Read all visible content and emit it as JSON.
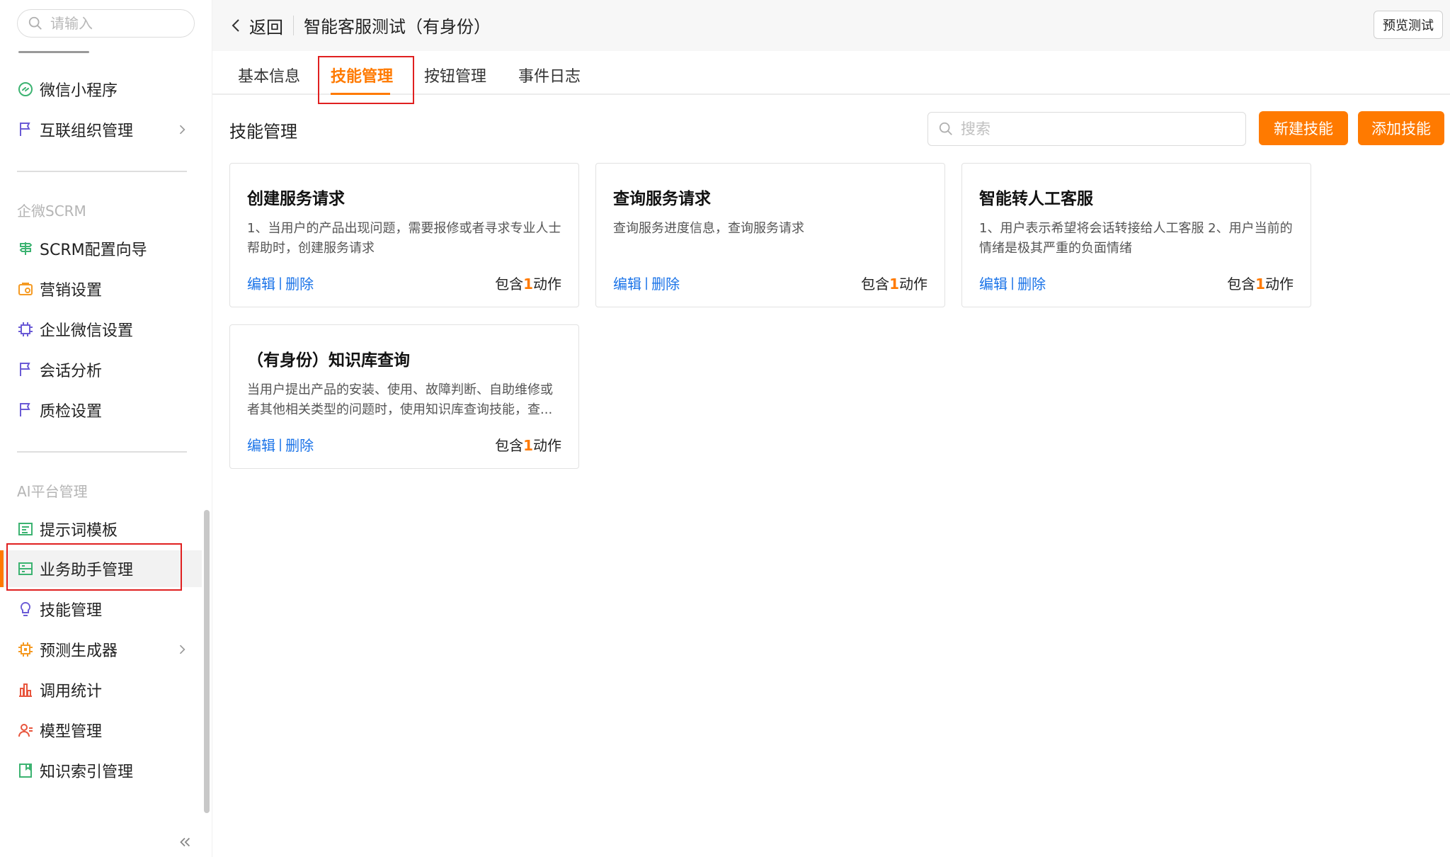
{
  "sidebar": {
    "search_placeholder": "请输入",
    "items_top": [
      {
        "label": "微信小程序",
        "icon": "wechat-mini-program-icon"
      },
      {
        "label": "互联组织管理",
        "icon": "flag-icon",
        "has_children": true
      }
    ],
    "group_scrm": {
      "title": "企微SCRM",
      "items": [
        {
          "label": "SCRM配置向导",
          "icon": "signpost-icon"
        },
        {
          "label": "营销设置",
          "icon": "marketing-icon"
        },
        {
          "label": "企业微信设置",
          "icon": "chip-icon"
        },
        {
          "label": "会话分析",
          "icon": "flag-icon"
        },
        {
          "label": "质检设置",
          "icon": "flag-icon"
        }
      ]
    },
    "group_ai": {
      "title": "AI平台管理",
      "items": [
        {
          "label": "提示词模板",
          "icon": "template-icon"
        },
        {
          "label": "业务助手管理",
          "icon": "assistant-icon",
          "active": true
        },
        {
          "label": "技能管理",
          "icon": "bulb-icon"
        },
        {
          "label": "预测生成器",
          "icon": "processor-icon",
          "has_children": true
        },
        {
          "label": "调用统计",
          "icon": "bar-stats-icon"
        },
        {
          "label": "模型管理",
          "icon": "user-model-icon"
        },
        {
          "label": "知识索引管理",
          "icon": "bookmark-icon"
        }
      ]
    },
    "colors": {
      "active_accent": "#ff7a00",
      "icon_green": "#3cb371",
      "icon_purple": "#6b5bd6",
      "icon_orange": "#f59a23",
      "icon_red": "#e8553d"
    }
  },
  "header": {
    "back_label": "返回",
    "title": "智能客服测试（有身份）",
    "preview_button": "预览测试"
  },
  "tabs": [
    {
      "label": "基本信息",
      "active": false
    },
    {
      "label": "技能管理",
      "active": true
    },
    {
      "label": "按钮管理",
      "active": false
    },
    {
      "label": "事件日志",
      "active": false
    }
  ],
  "content": {
    "section_title": "技能管理",
    "search_placeholder": "搜索",
    "new_skill_button": "新建技能",
    "add_skill_button": "添加技能",
    "edit_label": "编辑",
    "delete_label": "删除",
    "count_prefix": "包含",
    "count_suffix": "动作",
    "cards": [
      {
        "title": "创建服务请求",
        "desc": "1、当用户的产品出现问题，需要报修或者寻求专业人士帮助时，创建服务请求",
        "actions": "1"
      },
      {
        "title": "查询服务请求",
        "desc": "查询服务进度信息，查询服务请求",
        "actions": "1"
      },
      {
        "title": "智能转人工客服",
        "desc": "1、用户表示希望将会话转接给人工客服 2、用户当前的情绪是极其严重的负面情绪",
        "actions": "1"
      },
      {
        "title": "（有身份）知识库查询",
        "desc": "当用户提出产品的安装、使用、故障判断、自助维修或者其他相关类型的问题时，使用知识库查询技能，查...",
        "actions": "1"
      }
    ],
    "colors": {
      "accent": "#ff7a00",
      "link": "#1a73e8"
    }
  }
}
